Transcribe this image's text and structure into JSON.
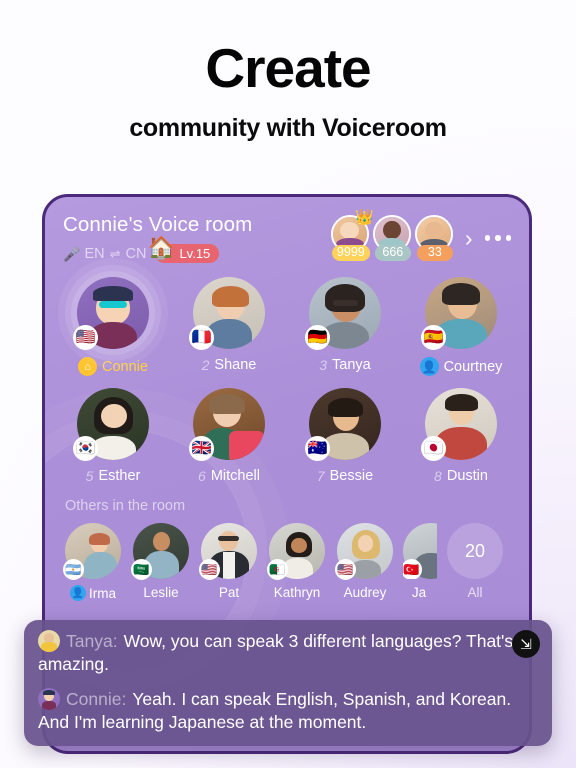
{
  "headline": {
    "title": "Create",
    "subtitle": "community with Voiceroom"
  },
  "room": {
    "title": "Connie's Voice room",
    "mic_icon": "microphone-icon",
    "language_from": "EN",
    "language_swap": "⇌",
    "language_to": "CN",
    "level_badge": "Lv.15",
    "house_icon": "house-icon",
    "chevron": "›",
    "more_icon": "more-options-icon",
    "top_supporters": [
      {
        "count": "9999",
        "color": "#ffd25a",
        "crown": true
      },
      {
        "count": "666",
        "color": "#a9c6c4",
        "crown": false
      },
      {
        "count": "33",
        "color": "#f4a05c",
        "crown": false
      }
    ]
  },
  "speakers": [
    {
      "num": "",
      "name": "Connie",
      "flag": "🇺🇸",
      "host": true,
      "speaking": true,
      "badge": "home"
    },
    {
      "num": "2",
      "name": "Shane",
      "flag": "🇫🇷",
      "host": false,
      "speaking": false,
      "badge": ""
    },
    {
      "num": "3",
      "name": "Tanya",
      "flag": "🇩🇪",
      "host": false,
      "speaking": false,
      "badge": ""
    },
    {
      "num": "",
      "name": "Courtney",
      "flag": "🇪🇸",
      "host": false,
      "speaking": false,
      "badge": "user"
    },
    {
      "num": "5",
      "name": "Esther",
      "flag": "🇰🇷",
      "host": false,
      "speaking": false,
      "badge": ""
    },
    {
      "num": "6",
      "name": "Mitchell",
      "flag": "🇬🇧",
      "host": false,
      "speaking": false,
      "badge": ""
    },
    {
      "num": "7",
      "name": "Bessie",
      "flag": "🇦🇺",
      "host": false,
      "speaking": false,
      "badge": ""
    },
    {
      "num": "8",
      "name": "Dustin",
      "flag": "🇯🇵",
      "host": false,
      "speaking": false,
      "badge": ""
    }
  ],
  "others": {
    "title": "Others in the room",
    "people": [
      {
        "name": "Irma",
        "flag": "🇦🇷",
        "badge": "user"
      },
      {
        "name": "Leslie",
        "flag": "🇸🇦",
        "badge": ""
      },
      {
        "name": "Pat",
        "flag": "🇺🇸",
        "badge": ""
      },
      {
        "name": "Kathryn",
        "flag": "🇩🇿",
        "badge": ""
      },
      {
        "name": "Audrey",
        "flag": "🇺🇸",
        "badge": ""
      },
      {
        "name": "Ja",
        "flag": "🇹🇷",
        "badge": ""
      }
    ],
    "all_count": "20",
    "all_label": "All"
  },
  "chat": {
    "expand_icon": "expand-icon",
    "messages": [
      {
        "speaker": "Tanya:",
        "text": "Wow, you can speak 3 different languages? That's amazing."
      },
      {
        "speaker": "Connie:",
        "text": "Yeah. I can speak English, Spanish, and Korean. And I'm learning Japanese at the moment."
      }
    ]
  },
  "colors": {
    "card_bg": "#ab8fd8",
    "card_border": "#4b2a7b",
    "host_accent": "#ffd23d",
    "level_badge": "#e8646e",
    "user_badge": "#30a5f0",
    "chat_bg": "#68538d"
  }
}
